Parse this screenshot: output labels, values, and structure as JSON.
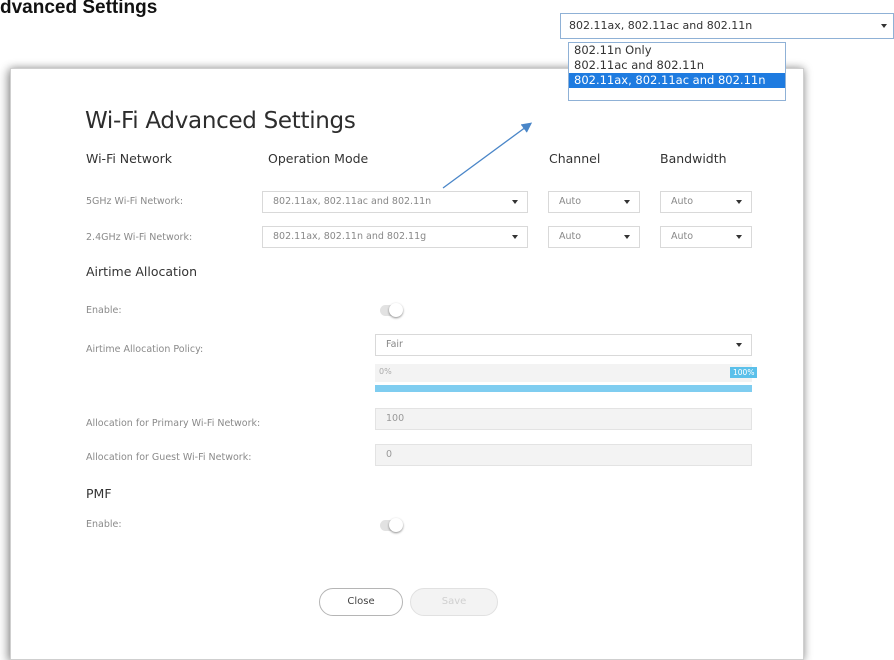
{
  "page_heading": "dvanced Settings",
  "dropdown": {
    "current_value": "802.11ax, 802.11ac and 802.11n",
    "options": [
      "802.11n Only",
      "802.11ac and 802.11n",
      "802.11ax, 802.11ac and 802.11n"
    ],
    "selected_index": 2
  },
  "dialog": {
    "title": "Wi-Fi Advanced Settings",
    "columns": {
      "network": "Wi-Fi Network",
      "mode": "Operation Mode",
      "channel": "Channel",
      "bandwidth": "Bandwidth"
    },
    "rows": [
      {
        "label": "5GHz Wi-Fi Network:",
        "mode": "802.11ax, 802.11ac and 802.11n",
        "channel": "Auto",
        "bandwidth": "Auto"
      },
      {
        "label": "2.4GHz Wi-Fi Network:",
        "mode": "802.11ax, 802.11n and 802.11g",
        "channel": "Auto",
        "bandwidth": "Auto"
      }
    ],
    "airtime": {
      "heading": "Airtime Allocation",
      "enable_label": "Enable:",
      "enabled": false,
      "policy_label": "Airtime Allocation Policy:",
      "policy_value": "Fair",
      "slider_min_label": "0%",
      "slider_max_label": "100%",
      "slider_value_fraction": 1.0,
      "primary_label": "Allocation for Primary Wi-Fi Network:",
      "primary_value": "100",
      "guest_label": "Allocation for Guest Wi-Fi Network:",
      "guest_value": "0"
    },
    "pmf": {
      "heading": "PMF",
      "enable_label": "Enable:",
      "enabled": false
    },
    "buttons": {
      "close": "Close",
      "save": "Save"
    }
  },
  "colors": {
    "accent": "#1e7be0",
    "slider": "#7fcdf0",
    "slider_badge": "#5bc0ea",
    "arrow": "#4a86c8"
  }
}
